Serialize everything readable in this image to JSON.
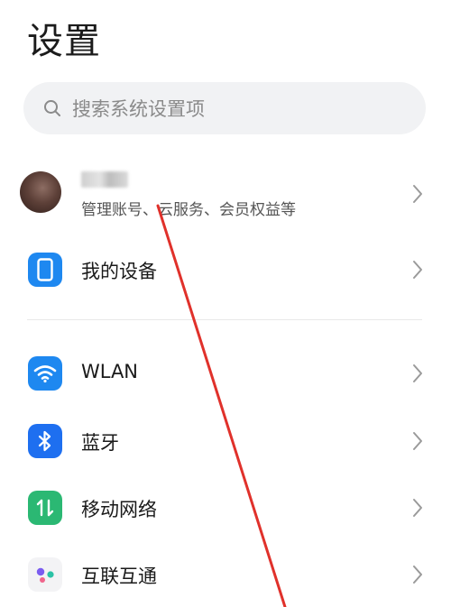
{
  "header": {
    "title": "设置"
  },
  "search": {
    "placeholder": "搜索系统设置项"
  },
  "account": {
    "name": "",
    "subtitle": "管理账号、云服务、会员权益等"
  },
  "items": [
    {
      "label": "我的设备",
      "value": "",
      "icon": "device-icon",
      "color": "#1e88f0"
    },
    {
      "label": "WLAN",
      "value": "",
      "icon": "wifi-icon",
      "color": "#1e88f0"
    },
    {
      "label": "蓝牙",
      "value": "",
      "icon": "bluetooth-icon",
      "color": "#1e6ff0"
    },
    {
      "label": "移动网络",
      "value": "",
      "icon": "mobile-network-icon",
      "color": "#2bb873"
    },
    {
      "label": "互联互通",
      "value": "",
      "icon": "interconnect-icon",
      "color": "#f3f3f5"
    }
  ],
  "colors": {
    "annotation_line": "#e0312b"
  }
}
